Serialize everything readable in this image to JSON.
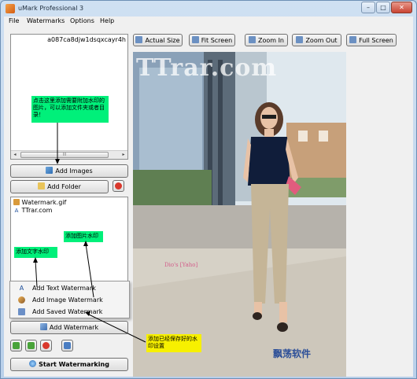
{
  "window": {
    "title": "uMark Professional 3",
    "minimize": "–",
    "maximize": "□",
    "close": "✕"
  },
  "menu": [
    "File",
    "Watermarks",
    "Options",
    "Help"
  ],
  "images_list": {
    "items": [
      "a087ca8djw1dsqxcayr4h"
    ],
    "scroll_thumb": "III"
  },
  "buttons": {
    "add_images": "Add Images",
    "add_folder": "Add Folder",
    "add_watermark": "Add Watermark",
    "start_watermarking": "Start Watermarking"
  },
  "watermarks_list": {
    "items": [
      "Watermark.gif",
      "TTrar.com"
    ]
  },
  "watermark_menu": [
    "Add Text Watermark",
    "Add Image Watermark",
    "Add Saved Watermark"
  ],
  "toolbar": [
    "Actual Size",
    "Fit Screen",
    "Zoom In",
    "Zoom Out",
    "Full Screen"
  ],
  "annotations": {
    "add_images_note": "点击这里添加需要附加水印的图片，可以添加文件夹或者目录！",
    "image_watermark_note": "添加图片水印",
    "text_watermark_note": "添加文字水印",
    "saved_watermark_note": "添加已经保存好的水印设置"
  },
  "overlay": {
    "ttrar_watermark": "TTrar.com",
    "image_stamp": "飘荡软件",
    "photo_small_text": "Dio's [Yaho]"
  },
  "colors": {
    "note_green": "#00f07a",
    "note_yellow": "#f7f000",
    "delete_red": "#d9382c",
    "nav_green": "#49a33a",
    "save_blue": "#4a7dc2",
    "stamp_blue": "#2c4f98"
  }
}
